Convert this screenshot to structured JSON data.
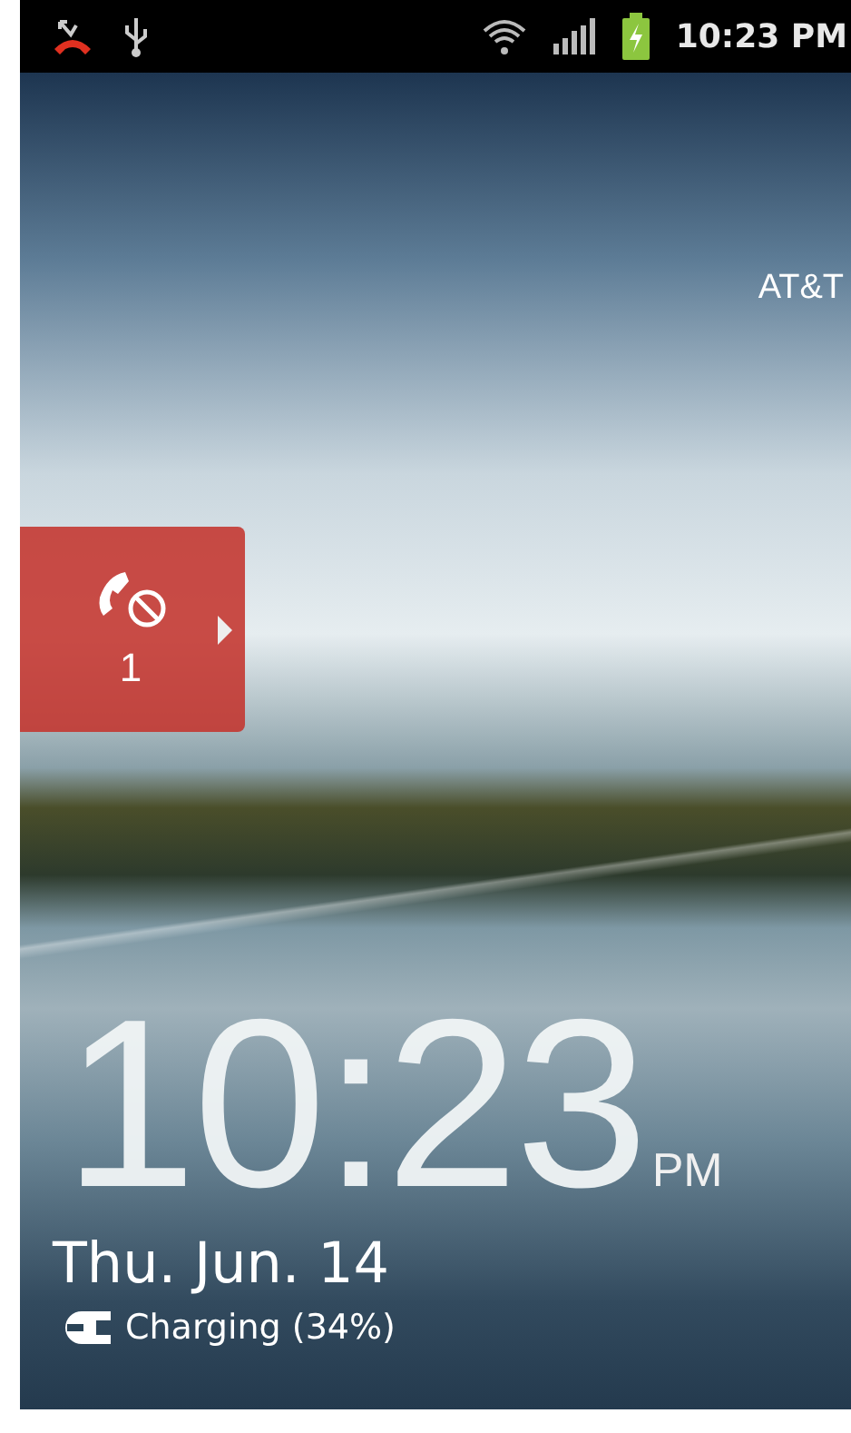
{
  "status_bar": {
    "time": "10:23 PM"
  },
  "carrier": "AT&T",
  "missed_calls": {
    "count": "1"
  },
  "clock": {
    "time": "10:23",
    "meridiem": "PM"
  },
  "date": "Thu. Jun. 14",
  "charging": "Charging (34%)"
}
